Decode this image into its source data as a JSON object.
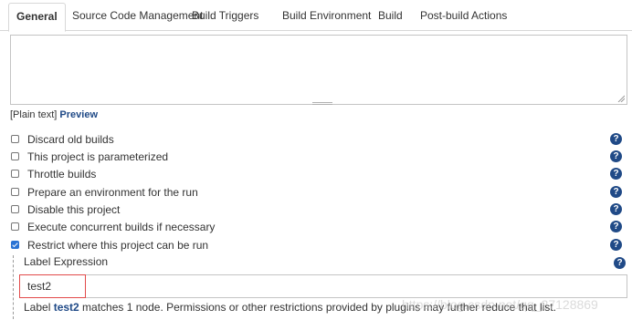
{
  "tabs": [
    {
      "label": "General",
      "active": true
    },
    {
      "label": "Source Code Management"
    },
    {
      "label": "Build Triggers"
    },
    {
      "label": "Build Environment"
    },
    {
      "label": "Build"
    },
    {
      "label": "Post-build Actions"
    }
  ],
  "description": {
    "value": "",
    "format_prefix": "[Plain text] ",
    "preview_link": "Preview"
  },
  "options": [
    {
      "label": "Discard old builds",
      "checked": false
    },
    {
      "label": "This project is parameterized",
      "checked": false
    },
    {
      "label": "Throttle builds",
      "checked": false
    },
    {
      "label": "Prepare an environment for the run",
      "checked": false
    },
    {
      "label": "Disable this project",
      "checked": false
    },
    {
      "label": "Execute concurrent builds if necessary",
      "checked": false
    },
    {
      "label": "Restrict where this project can be run",
      "checked": true
    }
  ],
  "help_glyph": "?",
  "label_expression": {
    "title": "Label Expression",
    "value": "test2",
    "match_prefix": "Label ",
    "match_label": "test2",
    "match_suffix": " matches 1 node. Permissions or other restrictions provided by plugins may further reduce that list."
  },
  "watermark": "https://blog.csdn.net/qq_27128869",
  "colors": {
    "link": "#204a87",
    "checkbox_checked": "#2a73d4",
    "highlight_box": "#e24a4a"
  }
}
